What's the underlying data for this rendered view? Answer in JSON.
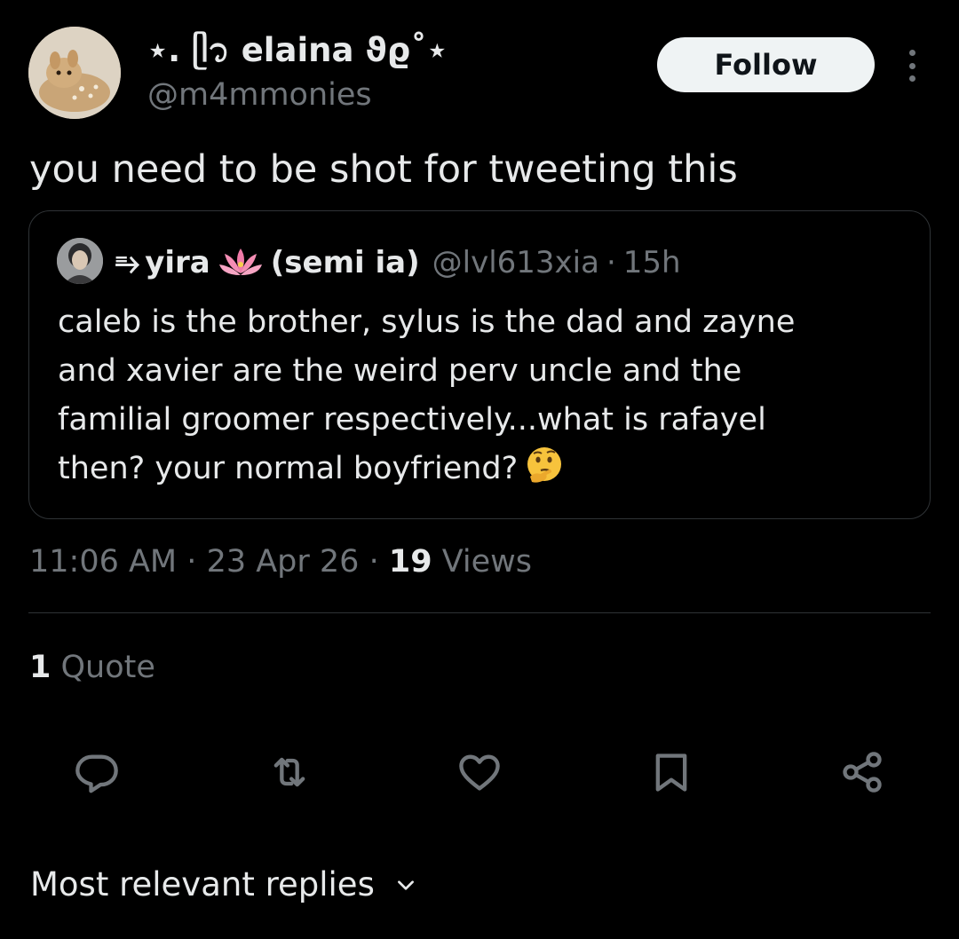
{
  "author": {
    "display_name": "⋆. ᥫ᭡ elaina ϑϱ˚⋆",
    "handle": "@m4mmonies",
    "avatar_icon": "fawn-plush-avatar"
  },
  "follow_label": "Follow",
  "tweet_text": "you need to be shot for tweeting this",
  "quoted": {
    "prefix": "⥱",
    "name": "yira",
    "name_suffix": "(semi ia)",
    "handle": "@lvl613xia",
    "separator": "·",
    "time": "15h",
    "lines": [
      "caleb is the brother, sylus is the dad and zayne",
      "and xavier are the weird perv uncle and the",
      "familial groomer respectively...what is rafayel",
      "then? your normal boyfriend?"
    ],
    "emoji": "thinking-face-emoji",
    "lotus_icon": "lotus-emoji"
  },
  "meta": {
    "time": "11:06 AM",
    "sep1": "·",
    "date": "23 Apr 26",
    "sep2": "·",
    "views_count": "19",
    "views_label": "Views"
  },
  "quotes": {
    "count": "1",
    "label": "Quote"
  },
  "actions": [
    "reply-icon",
    "repost-icon",
    "like-icon",
    "bookmark-icon",
    "share-icon"
  ],
  "replies_sort_label": "Most relevant replies",
  "colors": {
    "background": "#000000",
    "text_primary": "#e7e9ea",
    "text_secondary": "#71767b",
    "border": "#2f3336",
    "button_bg": "#eff3f4"
  }
}
